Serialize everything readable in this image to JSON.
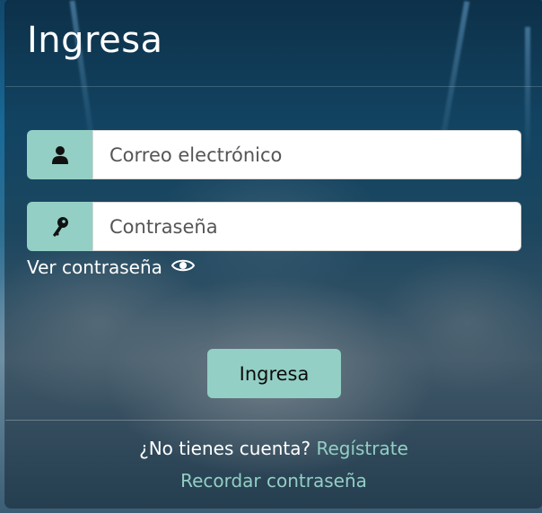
{
  "header": {
    "title": "Ingresa"
  },
  "form": {
    "email": {
      "placeholder": "Correo electrónico",
      "icon": "user-icon"
    },
    "password": {
      "placeholder": "Contraseña",
      "icon": "key-icon"
    },
    "show_password": {
      "label": "Ver contraseña",
      "icon": "eye-icon"
    },
    "submit_label": "Ingresa"
  },
  "footer": {
    "no_account_text": "¿No tienes cuenta?",
    "register_link": "Regístrate",
    "remind_link": "Recordar contraseña"
  },
  "colors": {
    "accent": "#93cfc4",
    "text": "#ffffff",
    "overlay": "rgba(8,22,34,0.45)"
  }
}
